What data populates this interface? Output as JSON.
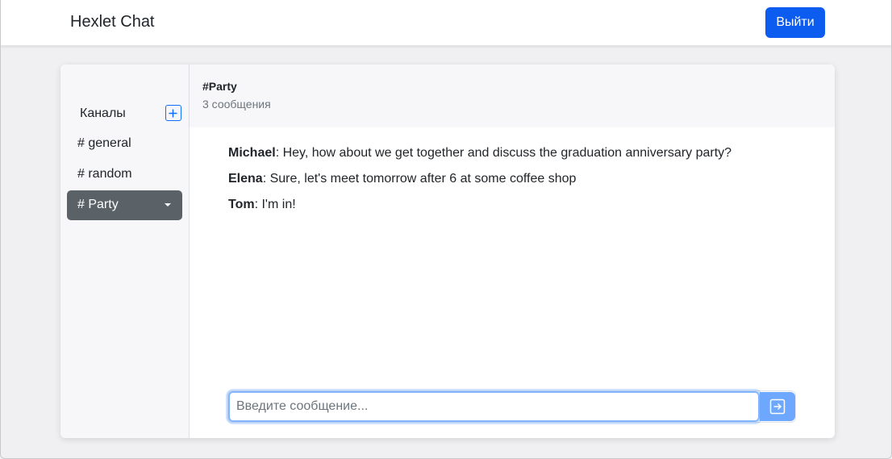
{
  "app": {
    "brand": "Hexlet Chat"
  },
  "header": {
    "logout_label": "Выйти"
  },
  "sidebar": {
    "title": "Каналы",
    "add_icon": "plus-square-icon",
    "channels": [
      {
        "label": "# general",
        "active": false
      },
      {
        "label": "# random",
        "active": false
      },
      {
        "label": "# Party",
        "active": true
      }
    ]
  },
  "chat": {
    "title": "#Party",
    "count": "3 сообщения",
    "messages": [
      {
        "author": "Michael",
        "text": ": Hey, how about we get together and discuss the graduation anniversary party?"
      },
      {
        "author": "Elena",
        "text": ": Sure, let's meet tomorrow after 6 at some coffee shop"
      },
      {
        "author": "Tom",
        "text": ": I'm in!"
      }
    ],
    "input_placeholder": "Введите сообщение...",
    "input_value": "",
    "send_icon": "arrow-right-square-icon"
  },
  "colors": {
    "primary": "#0d5cf0",
    "active_channel_bg": "#5a6268",
    "send_button_bg": "#6ea8fe"
  }
}
